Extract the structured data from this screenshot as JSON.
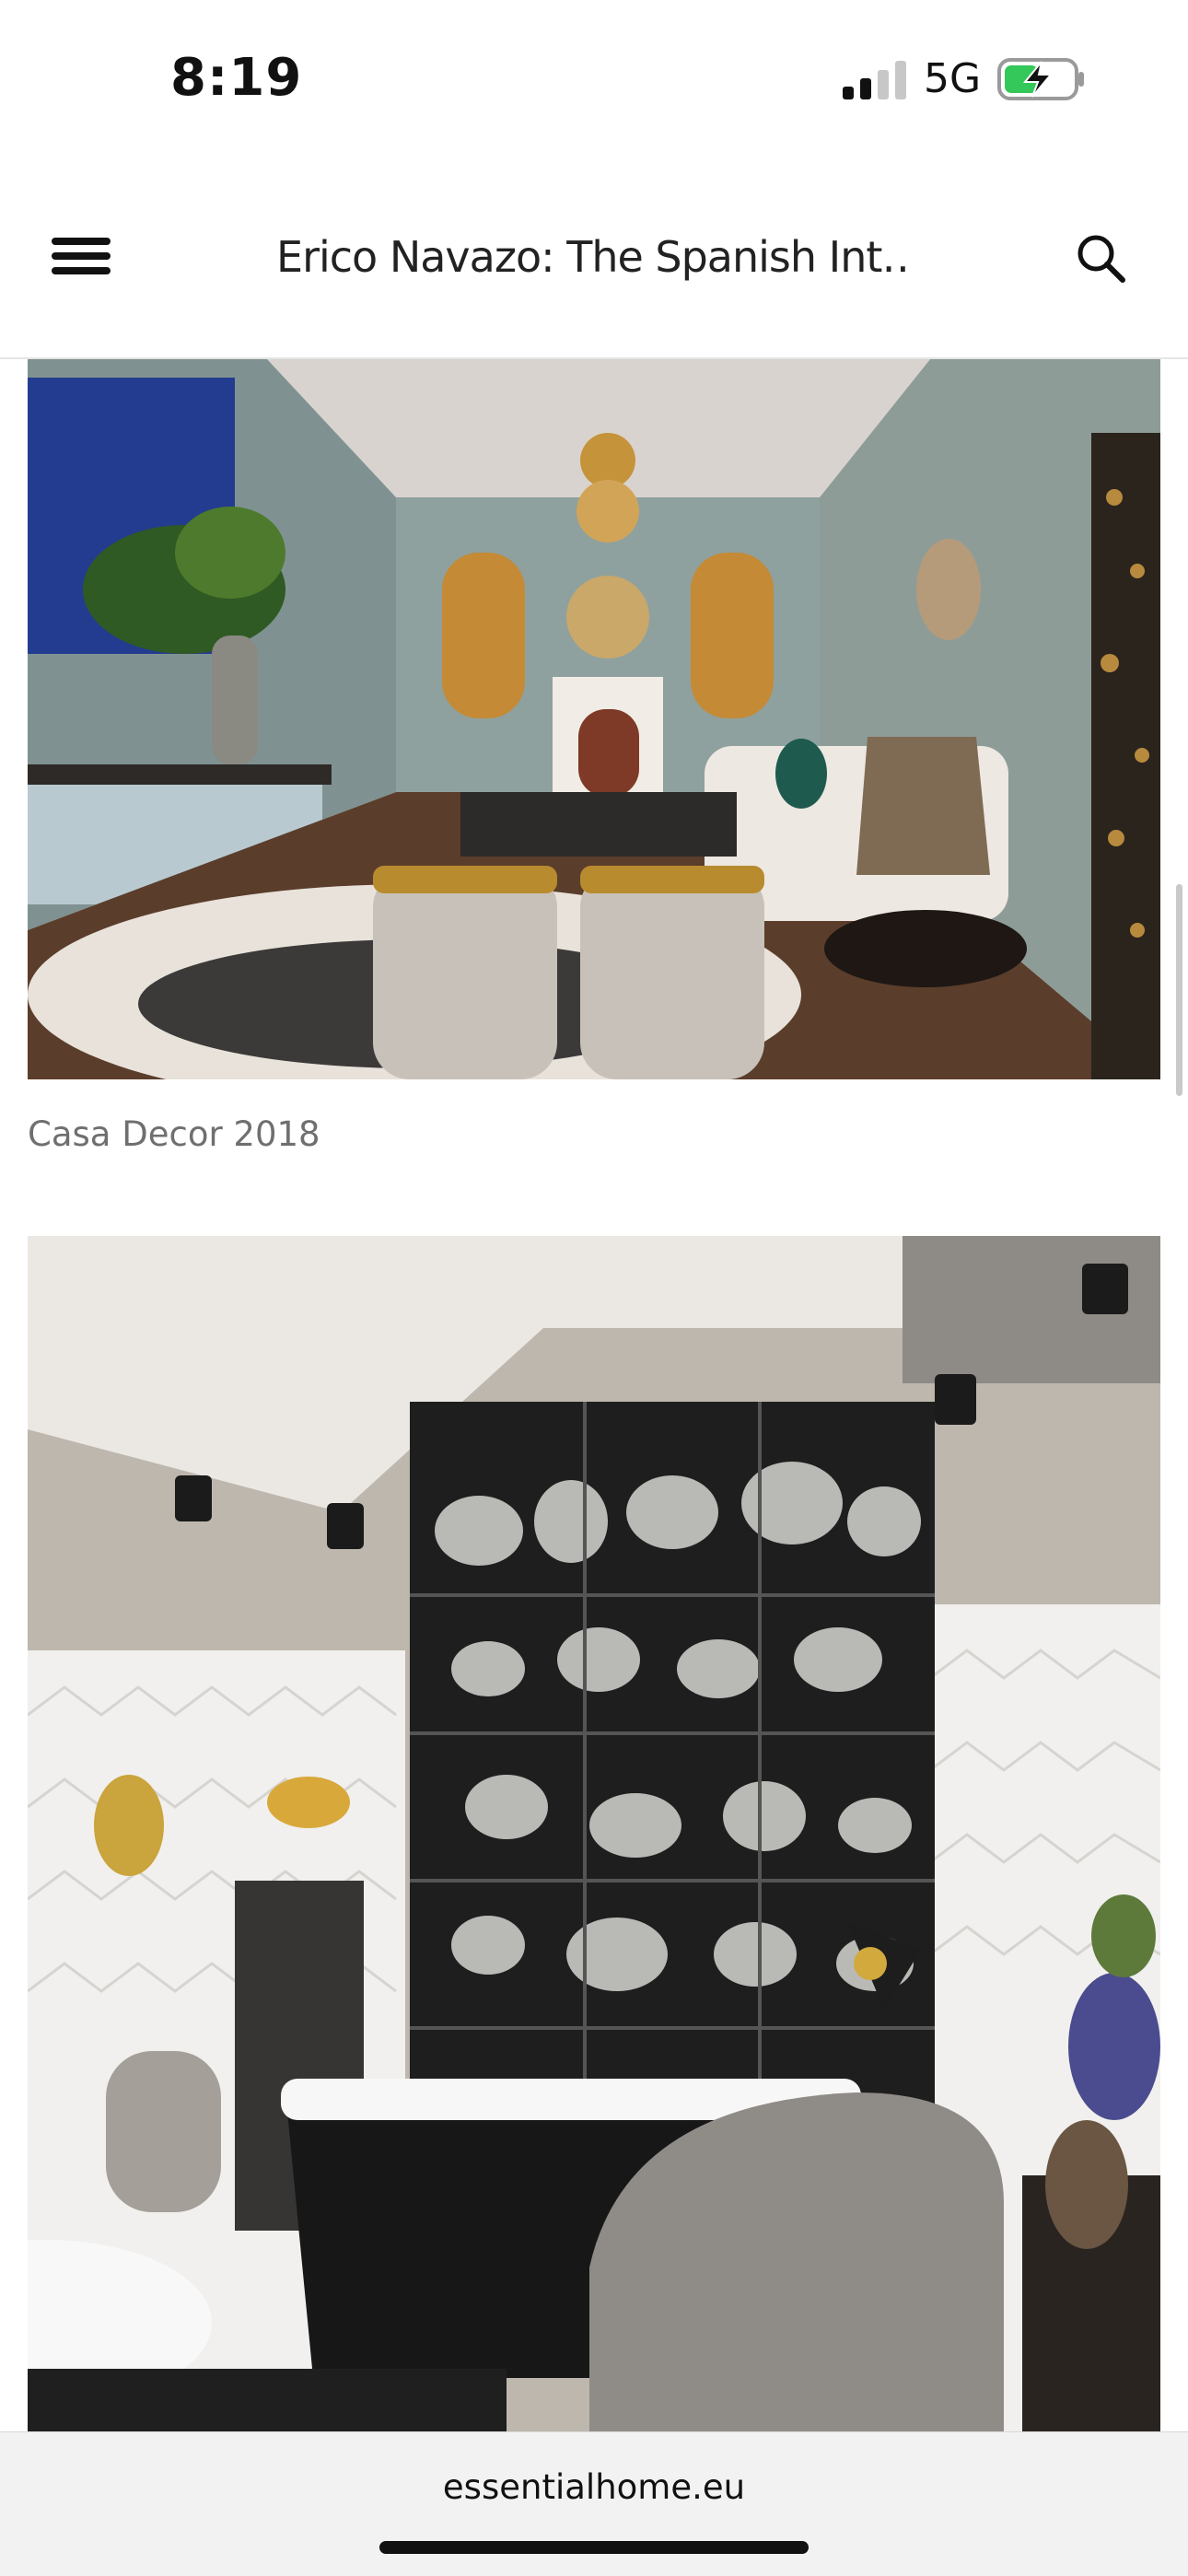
{
  "status_bar": {
    "time": "8:19",
    "network": "5G",
    "signal_bars_active": 2,
    "signal_bars_total": 4,
    "battery_state": "charging"
  },
  "nav": {
    "title": "Erico Navazo: The Spanish Int…",
    "menu_icon": "hamburger-menu-icon",
    "search_icon": "search-icon"
  },
  "article": {
    "images": [
      {
        "caption": "Casa Decor 2018"
      },
      {
        "caption": ""
      }
    ]
  },
  "browser": {
    "url": "essentialhome.eu"
  },
  "colors": {
    "battery_charge": "#34c759",
    "caption_text": "#6f6f6f",
    "bottom_bar": "#f2f2f2"
  }
}
